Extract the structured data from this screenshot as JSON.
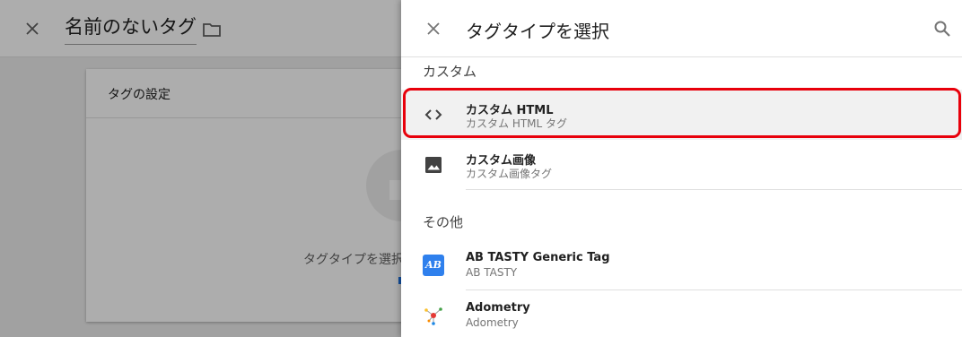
{
  "editor": {
    "title": "名前のないタグ",
    "close_icon": "close-icon",
    "folder_icon": "folder-icon",
    "card_title": "タグの設定",
    "card_hint": "タグタイプを選択"
  },
  "drawer": {
    "title": "タグタイプを選択",
    "close_icon": "close-icon",
    "search_icon": "search-icon",
    "sections": [
      {
        "label": "カスタム",
        "items": [
          {
            "name": "カスタム HTML",
            "sub": "カスタム HTML タグ",
            "icon": "code-icon",
            "selected": true
          },
          {
            "name": "カスタム画像",
            "sub": "カスタム画像タグ",
            "icon": "image-icon",
            "selected": false
          }
        ]
      },
      {
        "label": "その他",
        "items": [
          {
            "name": "AB TASTY Generic Tag",
            "sub": "AB TASTY",
            "icon": "ab-tasty-logo",
            "icon_text": "AB",
            "selected": false
          },
          {
            "name": "Adometry",
            "sub": "Adometry",
            "icon": "adometry-logo",
            "selected": false
          }
        ]
      }
    ]
  },
  "colors": {
    "highlight": "#e8000b",
    "ab_tasty_brand": "#2f80ed"
  }
}
